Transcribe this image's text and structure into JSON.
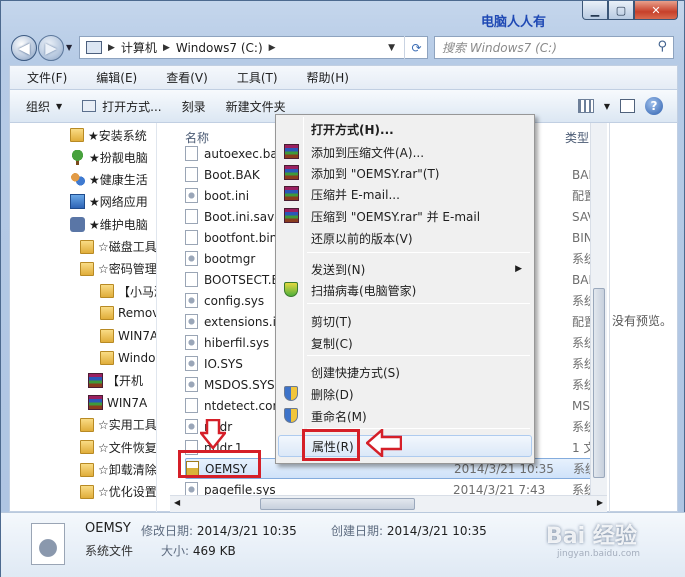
{
  "watermark_top": "电脑人人有",
  "address": {
    "segments": [
      "计算机",
      "Windows7 (C:)"
    ],
    "search_placeholder": "搜索 Windows7 (C:)"
  },
  "menubar": [
    "文件(F)",
    "编辑(E)",
    "查看(V)",
    "工具(T)",
    "帮助(H)"
  ],
  "toolbar": {
    "organize": "组织",
    "open_with": "打开方式...",
    "burn": "刻录",
    "new_folder": "新建文件夹"
  },
  "nav_tree": [
    {
      "label": "★安装系统",
      "icon": "folder"
    },
    {
      "label": "★扮靓电脑",
      "icon": "tree"
    },
    {
      "label": "★健康生活",
      "icon": "people"
    },
    {
      "label": "★网络应用",
      "icon": "network"
    },
    {
      "label": "★维护电脑",
      "icon": "gear"
    },
    {
      "label": "☆磁盘工具",
      "icon": "folder"
    },
    {
      "label": "☆密码管理",
      "icon": "folder"
    },
    {
      "label": "【小马激",
      "icon": "folder"
    },
    {
      "label": "Remove",
      "icon": "folder"
    },
    {
      "label": "WIN7A",
      "icon": "folder"
    },
    {
      "label": "Windo",
      "icon": "folder"
    },
    {
      "label": "【开机",
      "icon": "rar"
    },
    {
      "label": "WIN7A",
      "icon": "rar"
    },
    {
      "label": "☆实用工具",
      "icon": "folder"
    },
    {
      "label": "☆文件恢复",
      "icon": "folder"
    },
    {
      "label": "☆卸载清除",
      "icon": "folder"
    },
    {
      "label": "☆优化设置",
      "icon": "folder"
    }
  ],
  "columns": {
    "name": "名称",
    "type": "类型"
  },
  "files": [
    {
      "name": "autoexec.bat",
      "date": "",
      "type": ""
    },
    {
      "name": "Boot.BAK",
      "date": "",
      "type": "BAK"
    },
    {
      "name": "boot.ini",
      "date": "",
      "type": "配置"
    },
    {
      "name": "Boot.ini.saved",
      "date": "",
      "type": "SAV"
    },
    {
      "name": "bootfont.bin",
      "date": "",
      "type": "BIN"
    },
    {
      "name": "bootmgr",
      "date": "",
      "type": "系统"
    },
    {
      "name": "BOOTSECT.BAK",
      "date": "",
      "type": "BAK"
    },
    {
      "name": "config.sys",
      "date": "",
      "type": "系统"
    },
    {
      "name": "extensions.ini",
      "date": "",
      "type": "配置"
    },
    {
      "name": "hiberfil.sys",
      "date": "",
      "type": "系统"
    },
    {
      "name": "IO.SYS",
      "date": "",
      "type": "系统"
    },
    {
      "name": "MSDOS.SYS",
      "date": "",
      "type": "系统"
    },
    {
      "name": "ntdetect.com",
      "date": "",
      "type": "MS-"
    },
    {
      "name": "ntldr",
      "date": "",
      "type": "系统"
    },
    {
      "name": "ntldr.1",
      "date": "",
      "type": "1 文"
    },
    {
      "name": "OEMSY",
      "date": "2014/3/21 10:35",
      "type": "系统"
    },
    {
      "name": "pagefile.sys",
      "date": "2014/3/21 7:43",
      "type": "系统"
    }
  ],
  "preview_text": "没有预览。",
  "context_menu": [
    {
      "label": "打开方式(H)...",
      "icon": "none",
      "bold": true
    },
    {
      "label": "添加到压缩文件(A)...",
      "icon": "rar"
    },
    {
      "label": "添加到 \"OEMSY.rar\"(T)",
      "icon": "rar"
    },
    {
      "label": "压缩并 E-mail...",
      "icon": "rar"
    },
    {
      "label": "压缩到 \"OEMSY.rar\" 并 E-mail",
      "icon": "rar"
    },
    {
      "label": "还原以前的版本(V)",
      "icon": "none"
    },
    {
      "label": "发送到(N)",
      "icon": "none",
      "submenu": true
    },
    {
      "label": "扫描病毒(电脑管家)",
      "icon": "shield-green"
    },
    {
      "label": "剪切(T)",
      "icon": "none"
    },
    {
      "label": "复制(C)",
      "icon": "none"
    },
    {
      "label": "创建快捷方式(S)",
      "icon": "none"
    },
    {
      "label": "删除(D)",
      "icon": "shield"
    },
    {
      "label": "重命名(M)",
      "icon": "shield"
    },
    {
      "label": "属性(R)",
      "icon": "none"
    }
  ],
  "details": {
    "name": "OEMSY",
    "type": "系统文件",
    "modified_label": "修改日期:",
    "modified": "2014/3/21 10:35",
    "size_label": "大小:",
    "size": "469 KB",
    "created_label": "创建日期:",
    "created": "2014/3/21 10:35"
  },
  "watermark_bottom": {
    "main": "Bai 经验",
    "sub": "jingyan.baidu.com"
  },
  "colors": {
    "highlight": "#d51f28",
    "selection": "#cfe2f9"
  }
}
